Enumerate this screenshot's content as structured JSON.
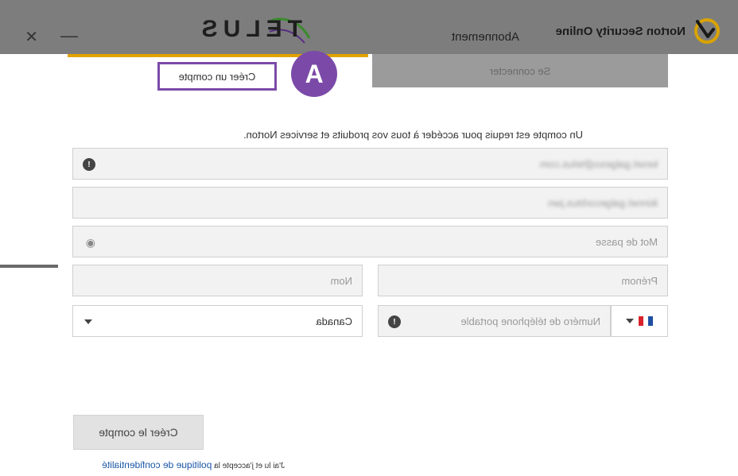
{
  "header": {
    "brand_name": "Norton Security Online",
    "nav_link": "Abonnement",
    "partner_logo": "TELUS",
    "minimize_symbol": "—",
    "close_symbol": "✕"
  },
  "tabs": {
    "login": "Se connecter",
    "create": "Créer un compte"
  },
  "callout": {
    "letter": "A"
  },
  "form": {
    "intro": "Un compte est requis pour accéder à tous vos produits et services Norton.",
    "email_value": "kesel.galgeso@telus.com",
    "email_confirm_value": "ikinnel.galgecorbtus.jwn",
    "password_placeholder": "Mot de passe",
    "firstname_placeholder": "Prénom",
    "lastname_placeholder": "Nom",
    "phone_placeholder": "Numéro de téléphone portable",
    "country_value": "Canada",
    "submit_label": "Créer le compte",
    "legal_prefix": "J'ai lu et j'accepte la ",
    "legal_link": "politique de confidentialité"
  },
  "icons": {
    "info": "info-icon",
    "eye": "eye-icon",
    "flag": "france-flag-icon",
    "caret": "chevron-down-icon"
  },
  "colors": {
    "callout_purple": "#7b4aa8",
    "tab_accent": "#e0a300",
    "link_blue": "#1a57a8"
  }
}
